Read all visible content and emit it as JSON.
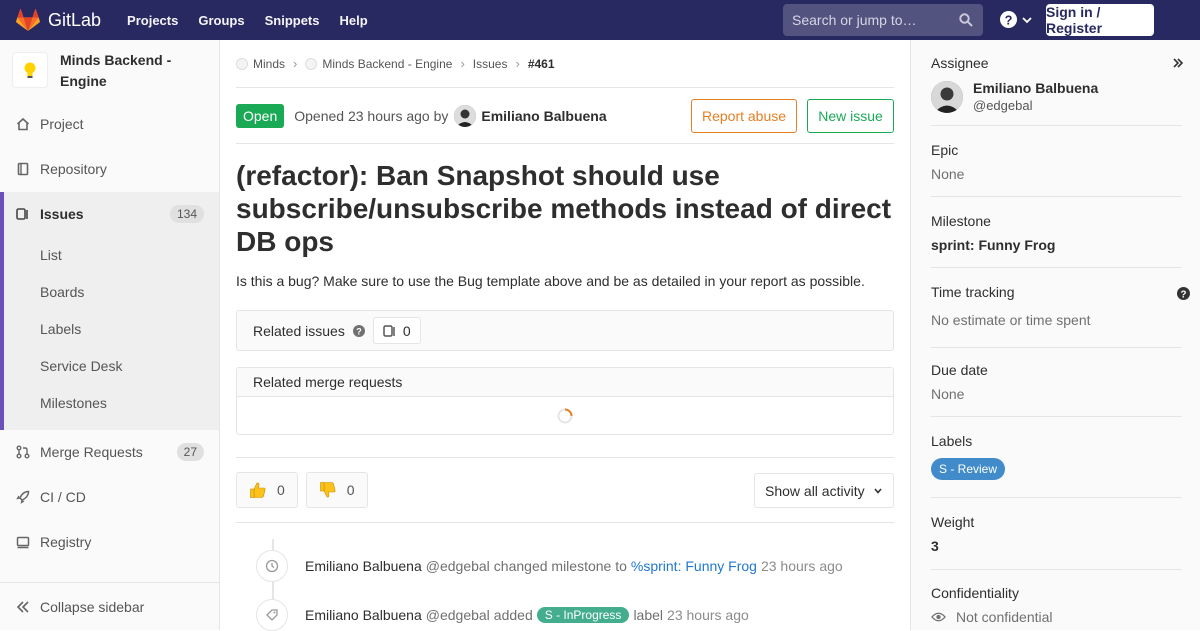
{
  "navbar": {
    "brand": "GitLab",
    "links": [
      "Projects",
      "Groups",
      "Snippets",
      "Help"
    ],
    "search_placeholder": "Search or jump to…",
    "signin_label": "Sign in / Register"
  },
  "sidebar": {
    "project_name": "Minds Backend - Engine",
    "items": [
      {
        "label": "Project",
        "icon": "home-icon"
      },
      {
        "label": "Repository",
        "icon": "doc-icon"
      },
      {
        "label": "Issues",
        "icon": "issues-icon",
        "count": "134"
      },
      {
        "label": "Merge Requests",
        "icon": "merge-request-icon",
        "count": "27"
      },
      {
        "label": "CI / CD",
        "icon": "rocket-icon"
      },
      {
        "label": "Registry",
        "icon": "container-icon"
      }
    ],
    "issues_subitems": [
      "List",
      "Boards",
      "Labels",
      "Service Desk",
      "Milestones"
    ],
    "collapse_label": "Collapse sidebar"
  },
  "breadcrumb": {
    "items": [
      "Minds",
      "Minds Backend - Engine",
      "Issues"
    ],
    "current": "#461"
  },
  "issue": {
    "status": "Open",
    "opened_text": "Opened 23 hours ago by",
    "author": "Emiliano Balbuena",
    "report_abuse_label": "Report abuse",
    "new_issue_label": "New issue",
    "title": "(refactor): Ban Snapshot should use subscribe/unsubscribe methods instead of direct DB ops",
    "description": "Is this a bug? Make sure to use the Bug template above and be as detailed in your report as possible."
  },
  "related_issues": {
    "label": "Related issues",
    "count": "0"
  },
  "related_mrs": {
    "label": "Related merge requests"
  },
  "awards": {
    "thumbsup": "0",
    "thumbsdown": "0"
  },
  "activity_filter": {
    "label": "Show all activity"
  },
  "notes": [
    {
      "author": "Emiliano Balbuena",
      "handle": "@edgebal",
      "action": "changed milestone to",
      "link": "%sprint: Funny Frog",
      "time": "23 hours ago"
    },
    {
      "author": "Emiliano Balbuena",
      "handle": "@edgebal",
      "action": "added",
      "label": "S - InProgress",
      "after": "label",
      "time": "23 hours ago"
    }
  ],
  "right_sidebar": {
    "assignee_title": "Assignee",
    "assignee_name": "Emiliano Balbuena",
    "assignee_handle": "@edgebal",
    "epic_title": "Epic",
    "epic_value": "None",
    "milestone_title": "Milestone",
    "milestone_value": "sprint: Funny Frog",
    "time_title": "Time tracking",
    "time_value": "No estimate or time spent",
    "due_title": "Due date",
    "due_value": "None",
    "labels_title": "Labels",
    "label_value": "S - Review",
    "weight_title": "Weight",
    "weight_value": "3",
    "conf_title": "Confidentiality",
    "conf_value": "Not confidential"
  },
  "colors": {
    "navbar": "#292961",
    "accent_purple": "#6b4fbb",
    "open_green": "#1aaa55",
    "abuse_orange": "#e67e22",
    "link_blue": "#1f78d1",
    "label_review": "#428bca",
    "label_inprogress": "#44ad8e"
  }
}
